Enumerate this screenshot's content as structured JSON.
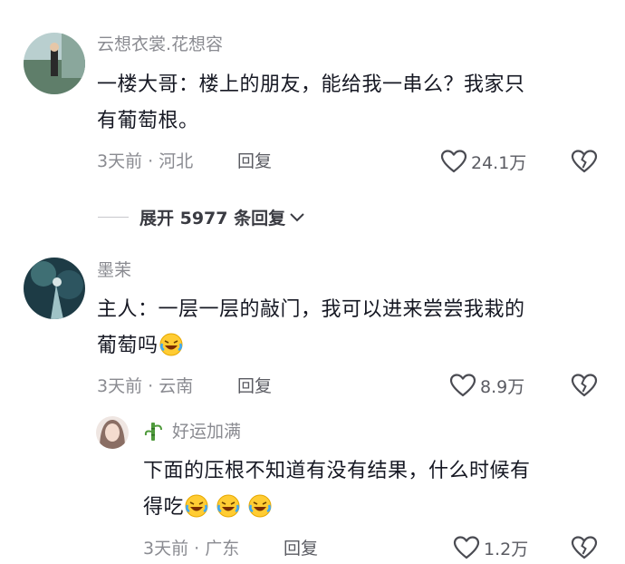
{
  "comments": [
    {
      "username": "云想衣裳.花想容",
      "content": [
        "一楼大哥：楼上的朋友，能给我一串么？我家只",
        "有葡萄根。"
      ],
      "time": "3天前",
      "location": "河北",
      "reply_label": "回复",
      "likes": "24.1万"
    },
    {
      "username": "墨茉",
      "content": [
        "主人：一层一层的敲门，我可以进来尝尝我栽的",
        "葡萄吗"
      ],
      "time": "3天前",
      "location": "云南",
      "reply_label": "回复",
      "likes": "8.9万"
    }
  ],
  "expand": {
    "label": "展开 5977 条回复"
  },
  "sub_reply": {
    "username": "好运加满",
    "content": [
      "下面的压根不知道有没有结果，什么时候有",
      "得吃"
    ],
    "time": "3天前",
    "location": "广东",
    "reply_label": "回复",
    "likes": "1.2万"
  },
  "separator": "·",
  "icons": {
    "like": "heart-outline-icon",
    "dislike": "broken-heart-icon",
    "emoji": "laughing-tears-emoji"
  }
}
